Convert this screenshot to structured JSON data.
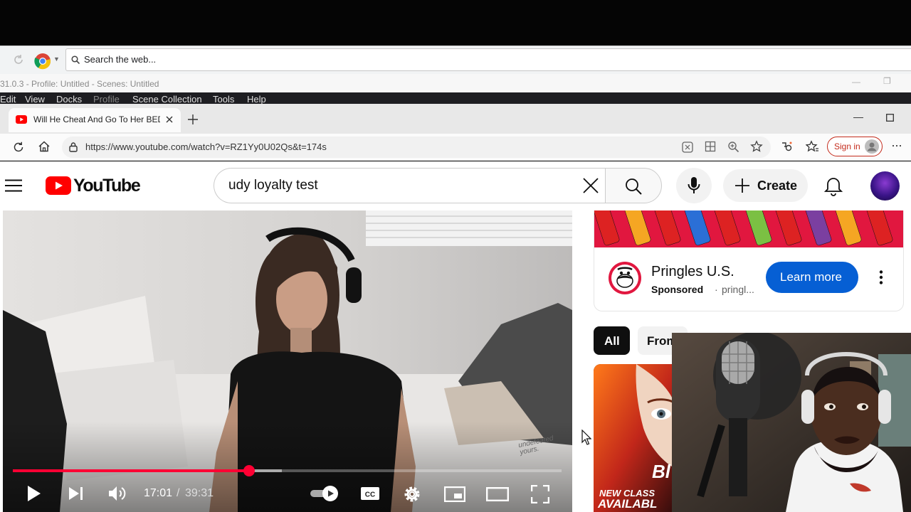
{
  "outer_browser": {
    "search_placeholder": "Search the web..."
  },
  "obs": {
    "title": "31.0.3 - Profile: Untitled - Scenes: Untitled",
    "menu": [
      "Edit",
      "View",
      "Docks",
      "Profile",
      "Scene Collection",
      "Tools",
      "Help"
    ]
  },
  "browser": {
    "tab_title": "Will He Cheat And Go To Her BED",
    "url": "https://www.youtube.com/watch?v=RZ1Yy0U02Qs&t=174s",
    "sign_in": "Sign in"
  },
  "youtube": {
    "logo_text": "YouTube",
    "search_query": "udy loyalty test",
    "create_label": "Create"
  },
  "player": {
    "time_current": "17:01",
    "time_total": "39:31",
    "progress": 0.43,
    "buffered": 0.49,
    "watermark": "undefeated yours."
  },
  "ad": {
    "advertiser": "Pringles U.S.",
    "sponsored": "Sponsored",
    "domain": "pringl...",
    "cta": "Learn more"
  },
  "chips": [
    "All",
    "From"
  ],
  "thumb": {
    "line1": "NEW CLASS",
    "line2": "AVAILABL",
    "mark": "Bl"
  },
  "colors": {
    "yt_red": "#ff0000",
    "progress_red": "#f03",
    "cta_blue": "#065fd4"
  }
}
